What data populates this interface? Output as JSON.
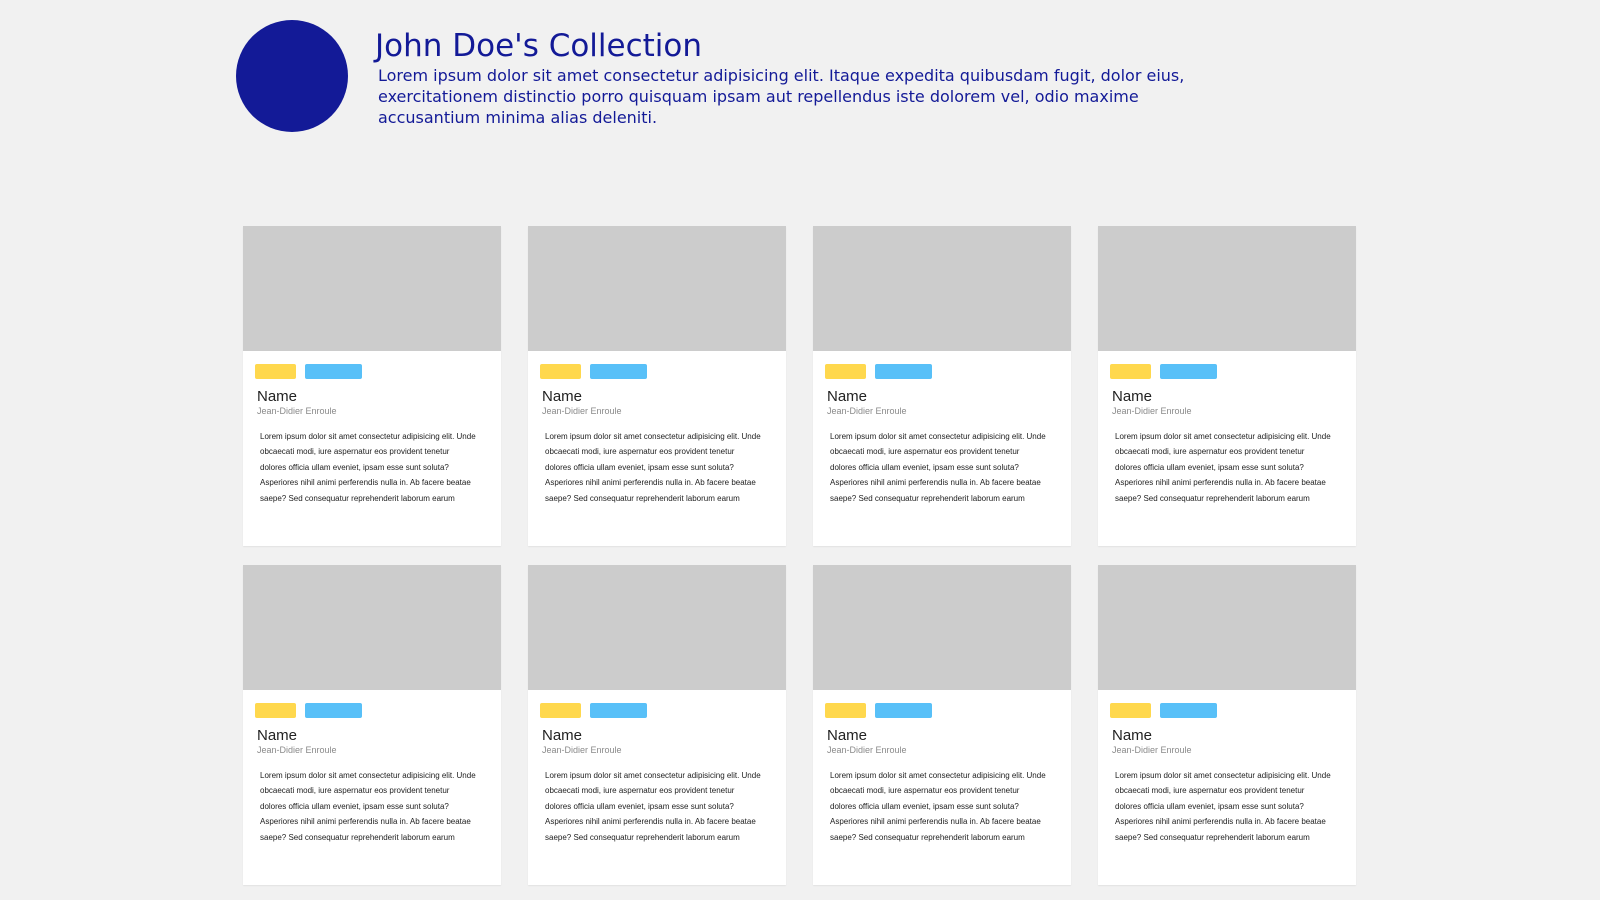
{
  "colors": {
    "background": "#f1f1f1",
    "accent": "#131a97",
    "tag_primary": "#ffd84d",
    "tag_secondary": "#58c0f8",
    "placeholder": "#cccccc"
  },
  "profile": {
    "title": "John Doe's Collection",
    "description": "Lorem ipsum dolor sit amet consectetur adipisicing elit. Itaque expedita quibusdam fugit, dolor eius, exercitationem distinctio porro quisquam ipsam aut repellendus iste dolorem vel, odio maxime accusantium minima alias deleniti."
  },
  "cards": [
    {
      "name": "Name",
      "author": "Jean-Didier Enroule",
      "description": "Lorem ipsum dolor sit amet consectetur adipisicing elit. Unde obcaecati modi, iure aspernatur eos provident tenetur dolores officia ullam eveniet, ipsam esse sunt soluta? Asperiores nihil animi perferendis nulla in. Ab facere beatae saepe? Sed consequatur reprehenderit laborum earum"
    },
    {
      "name": "Name",
      "author": "Jean-Didier Enroule",
      "description": "Lorem ipsum dolor sit amet consectetur adipisicing elit. Unde obcaecati modi, iure aspernatur eos provident tenetur dolores officia ullam eveniet, ipsam esse sunt soluta? Asperiores nihil animi perferendis nulla in. Ab facere beatae saepe? Sed consequatur reprehenderit laborum earum"
    },
    {
      "name": "Name",
      "author": "Jean-Didier Enroule",
      "description": "Lorem ipsum dolor sit amet consectetur adipisicing elit. Unde obcaecati modi, iure aspernatur eos provident tenetur dolores officia ullam eveniet, ipsam esse sunt soluta? Asperiores nihil animi perferendis nulla in. Ab facere beatae saepe? Sed consequatur reprehenderit laborum earum"
    },
    {
      "name": "Name",
      "author": "Jean-Didier Enroule",
      "description": "Lorem ipsum dolor sit amet consectetur adipisicing elit. Unde obcaecati modi, iure aspernatur eos provident tenetur dolores officia ullam eveniet, ipsam esse sunt soluta? Asperiores nihil animi perferendis nulla in. Ab facere beatae saepe? Sed consequatur reprehenderit laborum earum"
    },
    {
      "name": "Name",
      "author": "Jean-Didier Enroule",
      "description": "Lorem ipsum dolor sit amet consectetur adipisicing elit. Unde obcaecati modi, iure aspernatur eos provident tenetur dolores officia ullam eveniet, ipsam esse sunt soluta? Asperiores nihil animi perferendis nulla in. Ab facere beatae saepe? Sed consequatur reprehenderit laborum earum"
    },
    {
      "name": "Name",
      "author": "Jean-Didier Enroule",
      "description": "Lorem ipsum dolor sit amet consectetur adipisicing elit. Unde obcaecati modi, iure aspernatur eos provident tenetur dolores officia ullam eveniet, ipsam esse sunt soluta? Asperiores nihil animi perferendis nulla in. Ab facere beatae saepe? Sed consequatur reprehenderit laborum earum"
    },
    {
      "name": "Name",
      "author": "Jean-Didier Enroule",
      "description": "Lorem ipsum dolor sit amet consectetur adipisicing elit. Unde obcaecati modi, iure aspernatur eos provident tenetur dolores officia ullam eveniet, ipsam esse sunt soluta? Asperiores nihil animi perferendis nulla in. Ab facere beatae saepe? Sed consequatur reprehenderit laborum earum"
    },
    {
      "name": "Name",
      "author": "Jean-Didier Enroule",
      "description": "Lorem ipsum dolor sit amet consectetur adipisicing elit. Unde obcaecati modi, iure aspernatur eos provident tenetur dolores officia ullam eveniet, ipsam esse sunt soluta? Asperiores nihil animi perferendis nulla in. Ab facere beatae saepe? Sed consequatur reprehenderit laborum earum"
    }
  ]
}
